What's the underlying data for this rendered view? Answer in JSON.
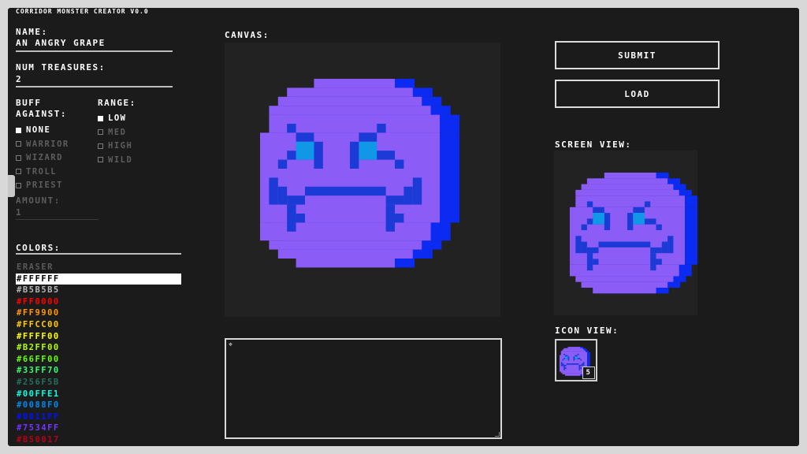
{
  "app": {
    "title": "CORRIDOR MONSTER CREATOR V0.0"
  },
  "name": {
    "label": "NAME:",
    "value": "AN ANGRY GRAPE"
  },
  "treasures": {
    "label": "NUM TREASURES:",
    "value": "2"
  },
  "buff": {
    "label_line1": "BUFF",
    "label_line2": "AGAINST:",
    "options": [
      {
        "label": "NONE",
        "checked": true
      },
      {
        "label": "WARRIOR",
        "checked": false
      },
      {
        "label": "WIZARD",
        "checked": false
      },
      {
        "label": "TROLL",
        "checked": false
      },
      {
        "label": "PRIEST",
        "checked": false
      }
    ],
    "amount_label": "AMOUNT:",
    "amount_value": "1"
  },
  "range": {
    "label": "RANGE:",
    "options": [
      {
        "label": "LOW",
        "checked": true
      },
      {
        "label": "MED",
        "checked": false
      },
      {
        "label": "HIGH",
        "checked": false
      },
      {
        "label": "WILD",
        "checked": false
      }
    ]
  },
  "colors": {
    "label": "COLORS:",
    "items": [
      {
        "label": "ERASER",
        "color": "#5a5a5a"
      },
      {
        "label": "#FFFFFF",
        "color": "#000000",
        "selected": true
      },
      {
        "label": "#B5B5B5",
        "color": "#b5b5b5"
      },
      {
        "label": "#FF0000",
        "color": "#ff0000"
      },
      {
        "label": "#FF9900",
        "color": "#ff9900"
      },
      {
        "label": "#FFCC00",
        "color": "#ffcc00"
      },
      {
        "label": "#FFFF00",
        "color": "#ffff00"
      },
      {
        "label": "#B2FF00",
        "color": "#b2ff00"
      },
      {
        "label": "#66FF00",
        "color": "#66ff00"
      },
      {
        "label": "#33FF70",
        "color": "#33ff70"
      },
      {
        "label": "#256F5B",
        "color": "#256f5b"
      },
      {
        "label": "#00FFE1",
        "color": "#00ffe1"
      },
      {
        "label": "#0088F0",
        "color": "#0088f0"
      },
      {
        "label": "#0011FF",
        "color": "#0011ff"
      },
      {
        "label": "#7534FF",
        "color": "#7534ff"
      },
      {
        "label": "#B50017",
        "color": "#b50017"
      }
    ]
  },
  "canvas": {
    "label": "CANVAS:"
  },
  "text_area": {
    "value": ""
  },
  "buttons": {
    "submit": "SUBMIT",
    "load": "LOAD"
  },
  "screen_view": {
    "label": "SCREEN VIEW:"
  },
  "icon_view": {
    "label": "ICON VIEW:",
    "count": "5"
  },
  "palette": {
    "body": "#8b5cf6",
    "shade": "#0b2bf2",
    "eye": "#1098e6",
    "line": "#1c3ad6",
    "bg": "#222222"
  }
}
